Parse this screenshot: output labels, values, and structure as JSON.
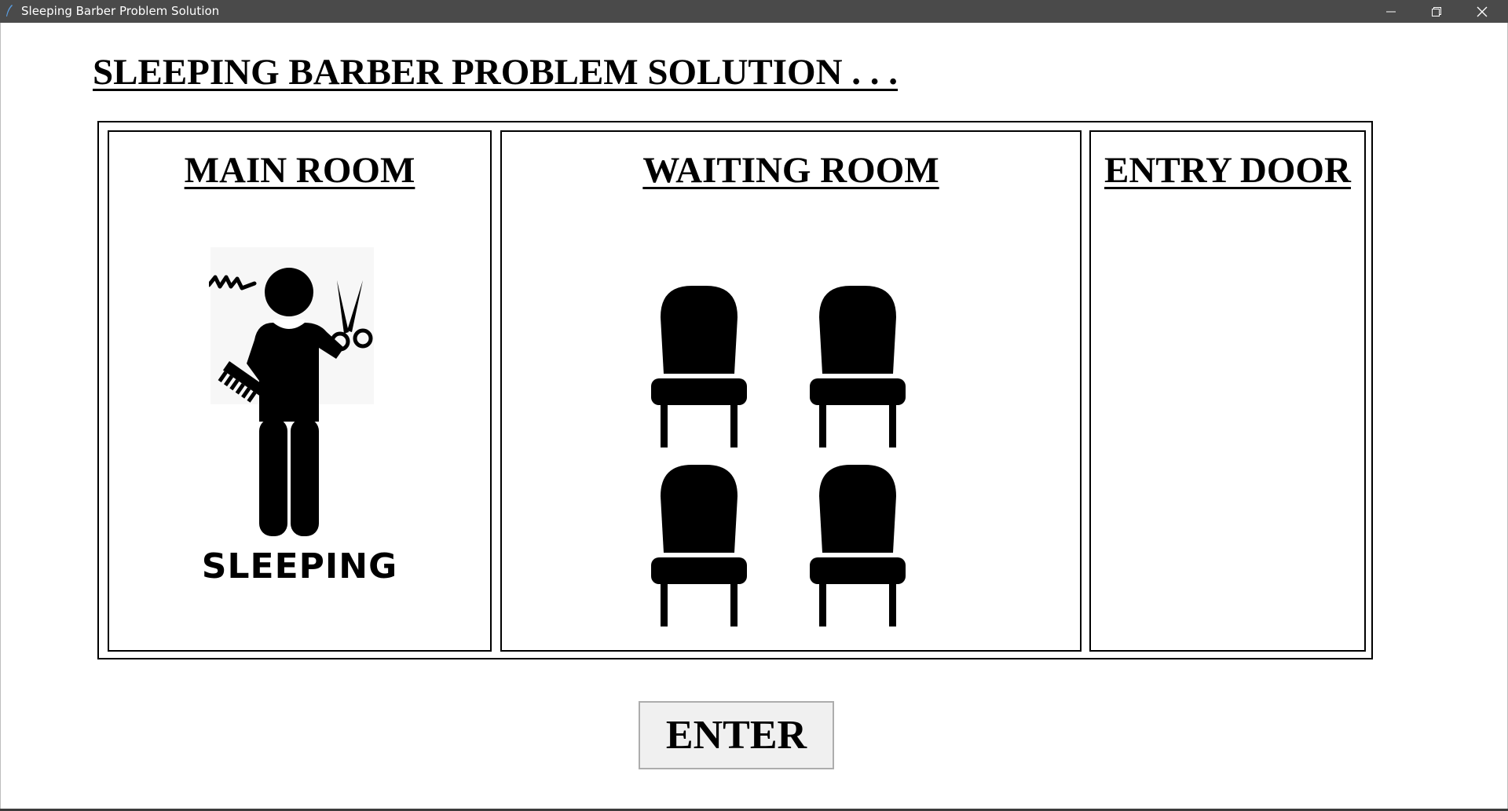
{
  "window": {
    "title": "Sleeping Barber Problem Solution",
    "app_icon": "feather-icon",
    "controls": [
      "minimize-icon",
      "restore-icon",
      "close-icon"
    ]
  },
  "page": {
    "title": "SLEEPING BARBER PROBLEM SOLUTION . . ."
  },
  "rooms": {
    "main": {
      "heading": "MAIN ROOM",
      "barber_icon": "barber-icon",
      "barber_status": "SLEEPING"
    },
    "waiting": {
      "heading": "WAITING ROOM",
      "chair_icon": "chair-icon",
      "chairs": [
        "empty",
        "empty",
        "empty",
        "empty"
      ]
    },
    "entry": {
      "heading": "ENTRY DOOR"
    }
  },
  "actions": {
    "enter_label": "ENTER"
  },
  "colors": {
    "titlebar": "#4a4a4a",
    "background": "#ffffff",
    "button": "#f0f0f0",
    "ink": "#000000"
  }
}
